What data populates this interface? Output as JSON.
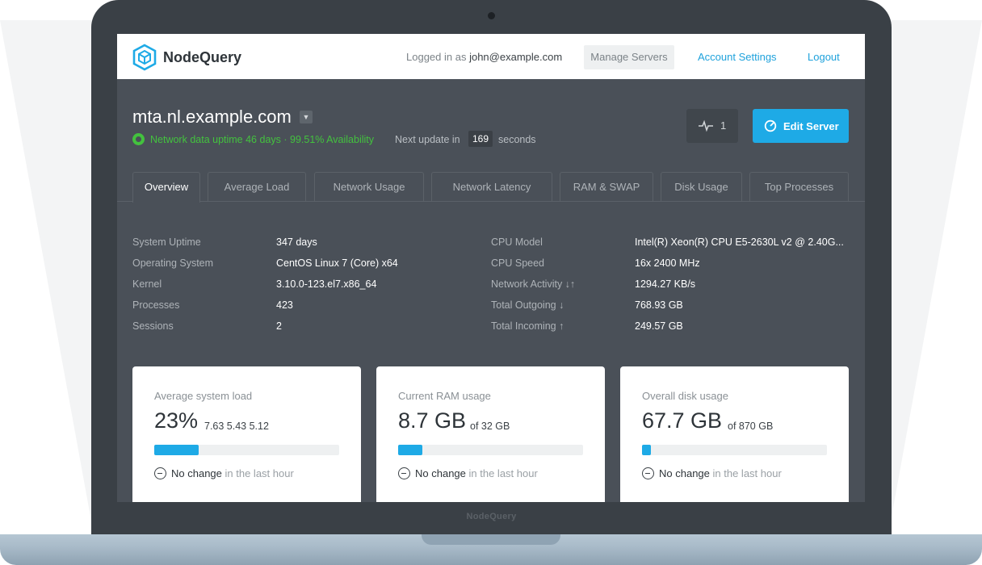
{
  "app": {
    "brand": "NodeQuery",
    "bezel_brand": "NodeQuery"
  },
  "nav": {
    "logged_prefix": "Logged in as",
    "user_email": "john@example.com",
    "manage_servers": "Manage Servers",
    "account_settings": "Account Settings",
    "logout": "Logout"
  },
  "server": {
    "hostname": "mta.nl.example.com",
    "uptime_text": "Network data uptime 46 days · 99.51% Availability",
    "next_update_label": "Next update in",
    "next_update_value": "169",
    "next_update_unit": "seconds",
    "alerts_count": "1",
    "edit_label": "Edit Server"
  },
  "tabs": [
    {
      "label": "Overview",
      "active": true
    },
    {
      "label": "Average Load"
    },
    {
      "label": "Network Usage"
    },
    {
      "label": "Network Latency"
    },
    {
      "label": "RAM & SWAP"
    },
    {
      "label": "Disk Usage"
    },
    {
      "label": "Top Processes"
    }
  ],
  "info_left": [
    {
      "label": "System Uptime",
      "value": "347 days"
    },
    {
      "label": "Operating System",
      "value": "CentOS Linux 7 (Core) x64"
    },
    {
      "label": "Kernel",
      "value": "3.10.0-123.el7.x86_64"
    },
    {
      "label": "Processes",
      "value": "423"
    },
    {
      "label": "Sessions",
      "value": "2"
    }
  ],
  "info_right": [
    {
      "label": "CPU Model",
      "value": "Intel(R) Xeon(R) CPU E5-2630L v2 @ 2.40G..."
    },
    {
      "label": "CPU Speed",
      "value": "16x 2400 MHz"
    },
    {
      "label": "Network Activity ↓↑",
      "value": "1294.27 KB/s"
    },
    {
      "label": "Total Outgoing ↓",
      "value": "768.93 GB"
    },
    {
      "label": "Total Incoming ↑",
      "value": "249.57 GB"
    }
  ],
  "cards": [
    {
      "title": "Average system load",
      "big": "23%",
      "small": "7.63 5.43 5.12",
      "fill": 0.24,
      "status_main": "No change",
      "status_muted": "in the last hour"
    },
    {
      "title": "Current RAM usage",
      "big": "8.7 GB",
      "small": "of 32 GB",
      "fill": 0.13,
      "status_main": "No change",
      "status_muted": "in the last hour"
    },
    {
      "title": "Overall disk usage",
      "big": "67.7 GB",
      "small": "of 870 GB",
      "fill": 0.05,
      "status_main": "No change",
      "status_muted": "in the last hour"
    }
  ],
  "colors": {
    "accent": "#1eaae6",
    "success": "#43c23e",
    "screen_bg": "#4a5058"
  }
}
